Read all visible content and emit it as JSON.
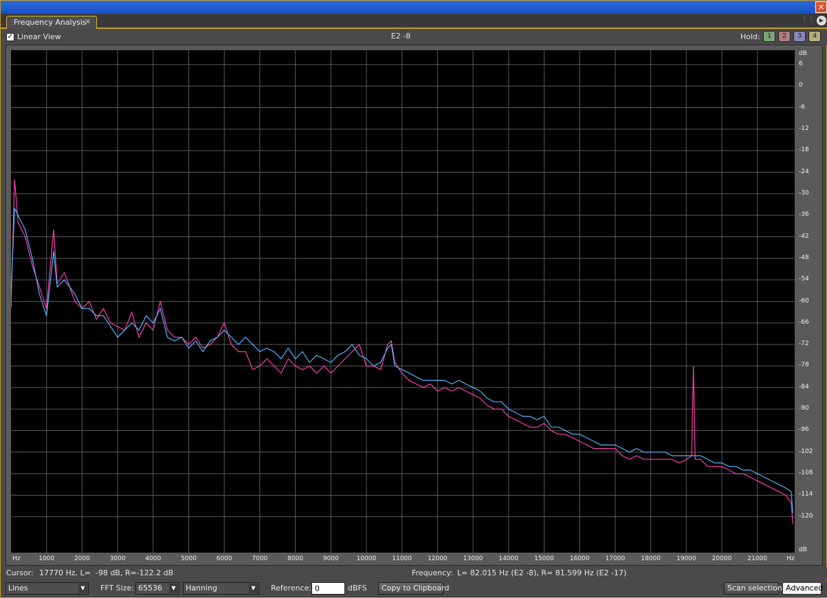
{
  "window": {
    "close_label": "×"
  },
  "tab": {
    "title": "Frequency Analysis",
    "close_label": "×"
  },
  "topbar": {
    "linear_view_checked": true,
    "linear_view_label": "Linear View",
    "note": "E2 -8",
    "hold_label": "Hold:",
    "hold_buttons": [
      "1",
      "2",
      "3",
      "4"
    ]
  },
  "status": {
    "cursor_label": "Cursor:",
    "cursor_value": "17770 Hz, L=  -98 dB, R=-122.2 dB",
    "frequency_label": "Frequency:",
    "frequency_value": "L= 82.015 Hz (E2 -8), R= 81.599 Hz (E2 -17)"
  },
  "controls": {
    "graph_type": "Lines",
    "fft_label": "FFT Size:",
    "fft_size": "65536",
    "window_func": "Hanning",
    "reference_label": "Reference:",
    "reference_value": "0",
    "reference_unit": "dBFS",
    "copy_button": "Copy to Clipboard",
    "scan_button": "Scan selection",
    "advanced_button": "Advanced"
  },
  "colors": {
    "background": "#000000",
    "grid": "#5a5a5a",
    "left_channel": "#ff3fb3",
    "right_channel": "#4fb8ff"
  },
  "chart_data": {
    "type": "line",
    "title": "",
    "xlabel": "Hz",
    "ylabel": "dB",
    "x_unit_label": "Hz",
    "y_unit_label": "dB",
    "xlim": [
      0,
      22050
    ],
    "ylim": [
      -130,
      10
    ],
    "grid": true,
    "x_ticks": [
      1000,
      2000,
      3000,
      4000,
      5000,
      6000,
      7000,
      8000,
      9000,
      10000,
      11000,
      12000,
      13000,
      14000,
      15000,
      16000,
      17000,
      18000,
      19000,
      20000,
      21000
    ],
    "y_ticks": [
      6,
      0,
      -6,
      -12,
      -18,
      -24,
      -30,
      -36,
      -42,
      -48,
      -54,
      -60,
      -66,
      -72,
      -78,
      -84,
      -90,
      -96,
      -102,
      -108,
      -114,
      -120
    ],
    "series": [
      {
        "color": "#ff3fb3",
        "x": [
          0,
          100,
          200,
          400,
          600,
          800,
          1000,
          1200,
          1300,
          1500,
          1800,
          2000,
          2200,
          2400,
          2600,
          2800,
          3000,
          3200,
          3400,
          3600,
          3800,
          4000,
          4200,
          4400,
          4600,
          4800,
          5000,
          5200,
          5400,
          5600,
          5800,
          6000,
          6200,
          6400,
          6600,
          6800,
          7000,
          7200,
          7400,
          7600,
          7800,
          8000,
          8200,
          8400,
          8600,
          8800,
          9000,
          9200,
          9400,
          9600,
          9800,
          10000,
          10200,
          10400,
          10600,
          10700,
          10800,
          11000,
          11200,
          11400,
          11600,
          11800,
          12000,
          12200,
          12400,
          12600,
          12800,
          13000,
          13200,
          13400,
          13600,
          13800,
          14000,
          14200,
          14400,
          14600,
          14800,
          15000,
          15200,
          15400,
          15600,
          15800,
          16000,
          16200,
          16400,
          16600,
          16800,
          17000,
          17200,
          17400,
          17600,
          17800,
          18000,
          18200,
          18400,
          18600,
          18800,
          19000,
          19150,
          19200,
          19250,
          19400,
          19600,
          19800,
          20000,
          20200,
          20400,
          20600,
          20800,
          21000,
          21200,
          21400,
          21600,
          21800,
          21950,
          22000
        ],
        "y": [
          -62,
          -26,
          -38,
          -42,
          -50,
          -56,
          -62,
          -40,
          -55,
          -52,
          -60,
          -62,
          -60,
          -65,
          -62,
          -66,
          -67,
          -68,
          -63,
          -70,
          -66,
          -68,
          -60,
          -68,
          -70,
          -70,
          -72,
          -70,
          -73,
          -72,
          -70,
          -66,
          -72,
          -74,
          -74,
          -79,
          -78,
          -76,
          -78,
          -80,
          -76,
          -78,
          -79,
          -78,
          -80,
          -78,
          -80,
          -78,
          -76,
          -74,
          -72,
          -78,
          -78,
          -79,
          -72,
          -71,
          -77,
          -80,
          -82,
          -83,
          -84,
          -83,
          -85,
          -84,
          -85,
          -84,
          -85,
          -86,
          -87,
          -89,
          -90,
          -90,
          -92,
          -93,
          -94,
          -95,
          -95,
          -94,
          -96,
          -97,
          -97,
          -98,
          -99,
          -100,
          -101,
          -101,
          -101,
          -101,
          -103,
          -104,
          -103,
          -104,
          -104,
          -104,
          -104,
          -104,
          -105,
          -104,
          -103,
          -78,
          -104,
          -104,
          -106,
          -106,
          -106,
          -107,
          -108,
          -108,
          -109,
          -110,
          -111,
          -112,
          -113,
          -114,
          -116,
          -122
        ]
      },
      {
        "color": "#4fb8ff",
        "x": [
          0,
          100,
          200,
          400,
          600,
          800,
          1000,
          1200,
          1300,
          1500,
          1800,
          2000,
          2200,
          2400,
          2600,
          2800,
          3000,
          3200,
          3400,
          3600,
          3800,
          4000,
          4200,
          4400,
          4600,
          4800,
          5000,
          5200,
          5400,
          5600,
          5800,
          6000,
          6200,
          6400,
          6600,
          6800,
          7000,
          7200,
          7400,
          7600,
          7800,
          8000,
          8200,
          8400,
          8600,
          8800,
          9000,
          9200,
          9400,
          9600,
          9800,
          10000,
          10200,
          10400,
          10600,
          10700,
          10800,
          11000,
          11200,
          11400,
          11600,
          11800,
          12000,
          12200,
          12400,
          12600,
          12800,
          13000,
          13200,
          13400,
          13600,
          13800,
          14000,
          14200,
          14400,
          14600,
          14800,
          15000,
          15200,
          15400,
          15600,
          15800,
          16000,
          16200,
          16400,
          16600,
          16800,
          17000,
          17200,
          17400,
          17600,
          17800,
          18000,
          18200,
          18400,
          18600,
          18800,
          19000,
          19150,
          19200,
          19250,
          19400,
          19600,
          19800,
          20000,
          20200,
          20400,
          20600,
          20800,
          21000,
          21200,
          21400,
          21600,
          21800,
          21950,
          22000
        ],
        "y": [
          -58,
          -34,
          -36,
          -40,
          -48,
          -58,
          -64,
          -46,
          -56,
          -54,
          -58,
          -62,
          -62,
          -64,
          -64,
          -67,
          -70,
          -68,
          -66,
          -68,
          -64,
          -66,
          -62,
          -70,
          -71,
          -70,
          -73,
          -71,
          -74,
          -71,
          -70,
          -68,
          -70,
          -72,
          -70,
          -72,
          -74,
          -73,
          -74,
          -76,
          -73,
          -76,
          -74,
          -77,
          -75,
          -76,
          -77,
          -75,
          -74,
          -72,
          -75,
          -76,
          -78,
          -77,
          -73,
          -72,
          -78,
          -79,
          -80,
          -81,
          -82,
          -82,
          -82,
          -82,
          -83,
          -82,
          -83,
          -84,
          -85,
          -87,
          -88,
          -88,
          -90,
          -91,
          -92,
          -92,
          -93,
          -92,
          -95,
          -95,
          -96,
          -97,
          -97,
          -98,
          -99,
          -100,
          -100,
          -100,
          -101,
          -102,
          -101,
          -102,
          -102,
          -102,
          -102,
          -103,
          -103,
          -103,
          -103,
          -103,
          -103,
          -103,
          -104,
          -105,
          -105,
          -106,
          -106,
          -107,
          -107,
          -108,
          -109,
          -110,
          -111,
          -112,
          -113,
          -119
        ]
      }
    ]
  }
}
